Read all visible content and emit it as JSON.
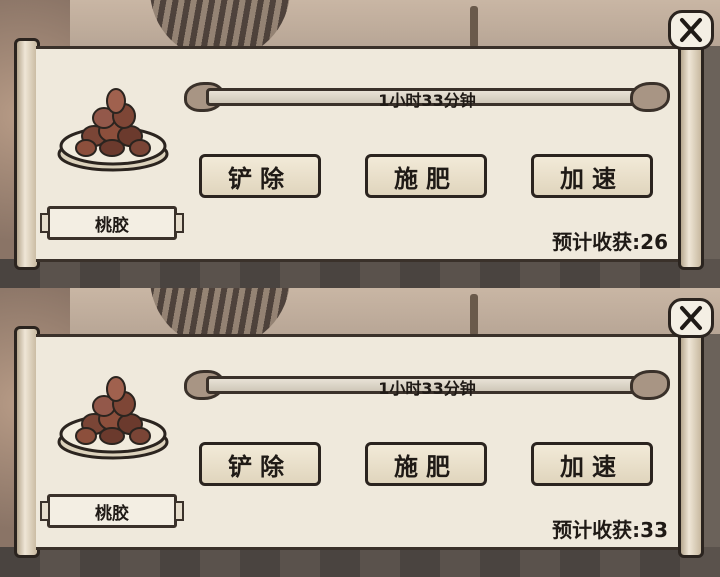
{
  "frames": [
    {
      "timer_text": "1小时33分钟",
      "buttons": {
        "remove": "铲除",
        "fertilize": "施肥",
        "speedup": "加速"
      },
      "item_name": "桃胶",
      "harvest_label": "预计收获:",
      "harvest_value": "26",
      "close_icon": "close-x-icon"
    },
    {
      "timer_text": "1小时33分钟",
      "buttons": {
        "remove": "铲除",
        "fertilize": "施肥",
        "speedup": "加速"
      },
      "item_name": "桃胶",
      "harvest_label": "预计收获:",
      "harvest_value": "33",
      "close_icon": "close-x-icon"
    }
  ],
  "colors": {
    "paper": "#efe9dc",
    "ink": "#2b241f",
    "button": "#f2ead8"
  }
}
